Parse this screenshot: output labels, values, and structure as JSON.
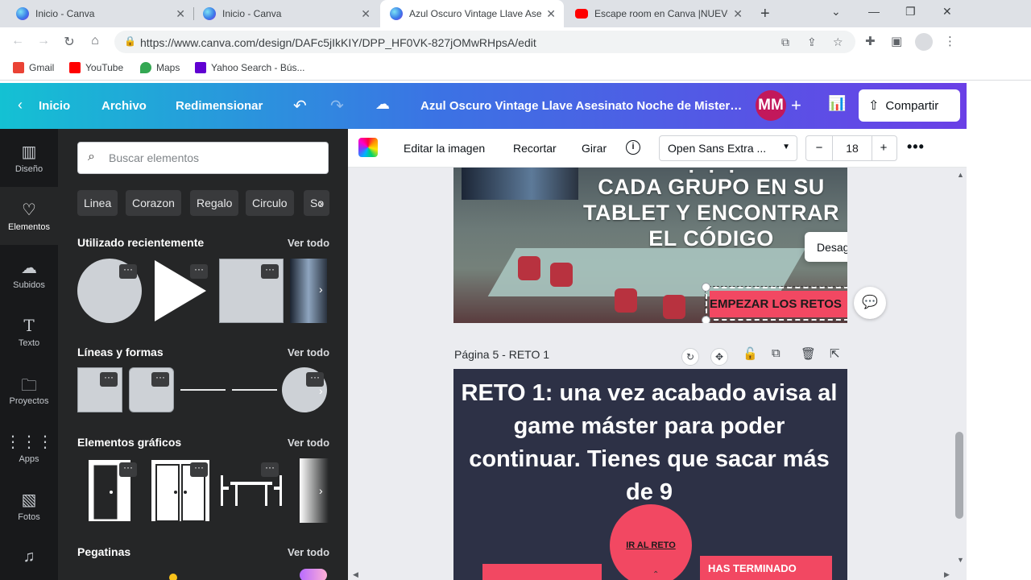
{
  "browser": {
    "tabs": [
      {
        "title": "Inicio - Canva",
        "favicon": "canva-icon",
        "active": false
      },
      {
        "title": "Inicio - Canva",
        "favicon": "canva-icon",
        "active": false
      },
      {
        "title": "Azul Oscuro Vintage Llave Asesi",
        "favicon": "canva-icon",
        "active": true
      },
      {
        "title": "Escape room en Canva |NUEVO",
        "favicon": "youtube-icon",
        "active": false
      }
    ],
    "url": "https://www.canva.com/design/DAFc5jIkKIY/DPP_HF0VK-827jOMwRHpsA/edit",
    "bookmarks": [
      {
        "label": "Gmail",
        "color": "#ea4335"
      },
      {
        "label": "YouTube",
        "color": "#ff0000"
      },
      {
        "label": "Maps",
        "color": "#34a853"
      },
      {
        "label": "Yahoo Search - Bús...",
        "color": "#6001d2"
      }
    ]
  },
  "header": {
    "home": "Inicio",
    "file": "Archivo",
    "resize": "Redimensionar",
    "doc_title": "Azul Oscuro Vintage Llave Asesinato Noche de Misterio I...",
    "avatar": "MM",
    "share": "Compartir"
  },
  "rail": [
    {
      "label": "Diseño",
      "icon": "layout-icon"
    },
    {
      "label": "Elementos",
      "icon": "shapes-icon"
    },
    {
      "label": "Subidos",
      "icon": "cloud-upload-icon"
    },
    {
      "label": "Texto",
      "icon": "text-icon"
    },
    {
      "label": "Proyectos",
      "icon": "folder-icon"
    },
    {
      "label": "Apps",
      "icon": "apps-grid-icon"
    },
    {
      "label": "Fotos",
      "icon": "photo-icon"
    }
  ],
  "panel": {
    "search_placeholder": "Buscar elementos",
    "chips": [
      "Linea",
      "Corazon",
      "Regalo",
      "Circulo",
      "So"
    ],
    "sections": {
      "recent": "Utilizado recientemente",
      "lines": "Líneas y formas",
      "graphics": "Elementos gráficos",
      "stickers": "Pegatinas"
    },
    "see_all": "Ver todo"
  },
  "toolbar": {
    "edit_image": "Editar la imagen",
    "crop": "Recortar",
    "rotate": "Girar",
    "font": "Open Sans Extra ...",
    "size": "18"
  },
  "canvas": {
    "page4_text": [
      "CADA GRUPO EN SU",
      "TABLET Y ENCONTRAR",
      "EL CÓDIGO"
    ],
    "button_label": "EMPEZAR LOS RETOS",
    "popup_label": "Desagrupar",
    "page5_label": "Página 5 - RETO 1",
    "page5_text": "RETO 1: una vez acabado avisa al game máster para poder continuar. Tienes que sacar más de 9",
    "circle_label": "IR AL RETO",
    "bar_label": "HAS TERMINADO"
  }
}
